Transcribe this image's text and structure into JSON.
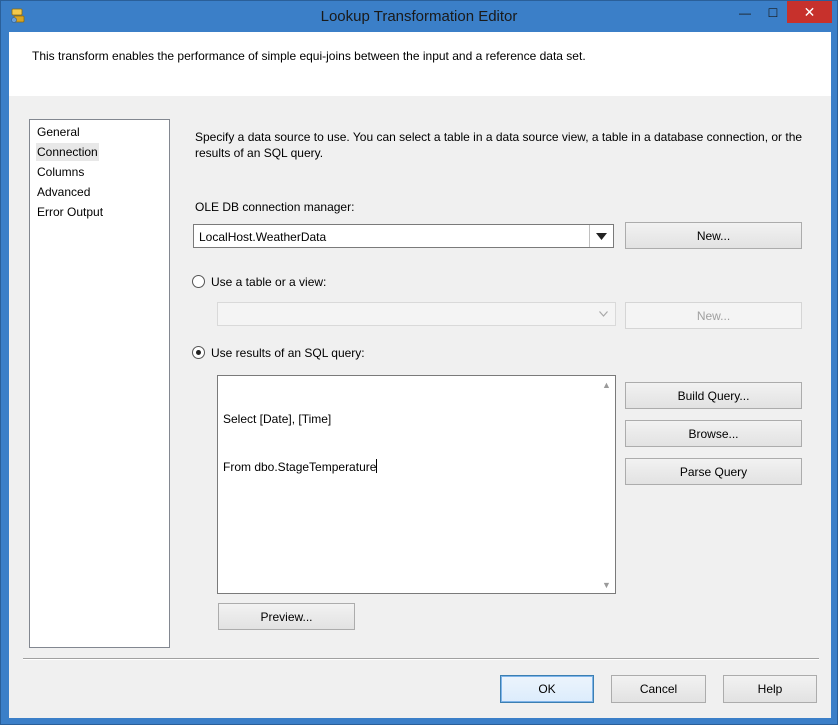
{
  "window": {
    "title": "Lookup Transformation Editor",
    "minimize_glyph": "—",
    "maximize_glyph": "☐",
    "close_glyph": "✕"
  },
  "description": "This transform enables the performance of simple equi-joins between the input and a reference data set.",
  "nav": {
    "items": [
      {
        "label": "General"
      },
      {
        "label": "Connection",
        "selected": true
      },
      {
        "label": "Columns"
      },
      {
        "label": "Advanced"
      },
      {
        "label": "Error Output"
      }
    ]
  },
  "connection": {
    "intro": "Specify a data source to use. You can select a table in a data source view, a table in a database connection, or the results of an SQL query.",
    "ole_label": "OLE DB connection manager:",
    "ole_value": "LocalHost.WeatherData",
    "new_button": "New...",
    "table_option_label": "Use a table or a view:",
    "table_value": "",
    "table_new_button": "New...",
    "sql_option_label": "Use results of an SQL query:",
    "sql_lines": [
      "Select [Date], [Time]",
      "From dbo.StageTemperature"
    ],
    "build_query_button": "Build Query...",
    "browse_button": "Browse...",
    "parse_query_button": "Parse Query",
    "preview_button": "Preview..."
  },
  "footer": {
    "ok": "OK",
    "cancel": "Cancel",
    "help": "Help"
  },
  "colors": {
    "title_bar": "#3b7fc8",
    "close_button": "#c7312c",
    "dialog_background": "#f0f0f0"
  }
}
